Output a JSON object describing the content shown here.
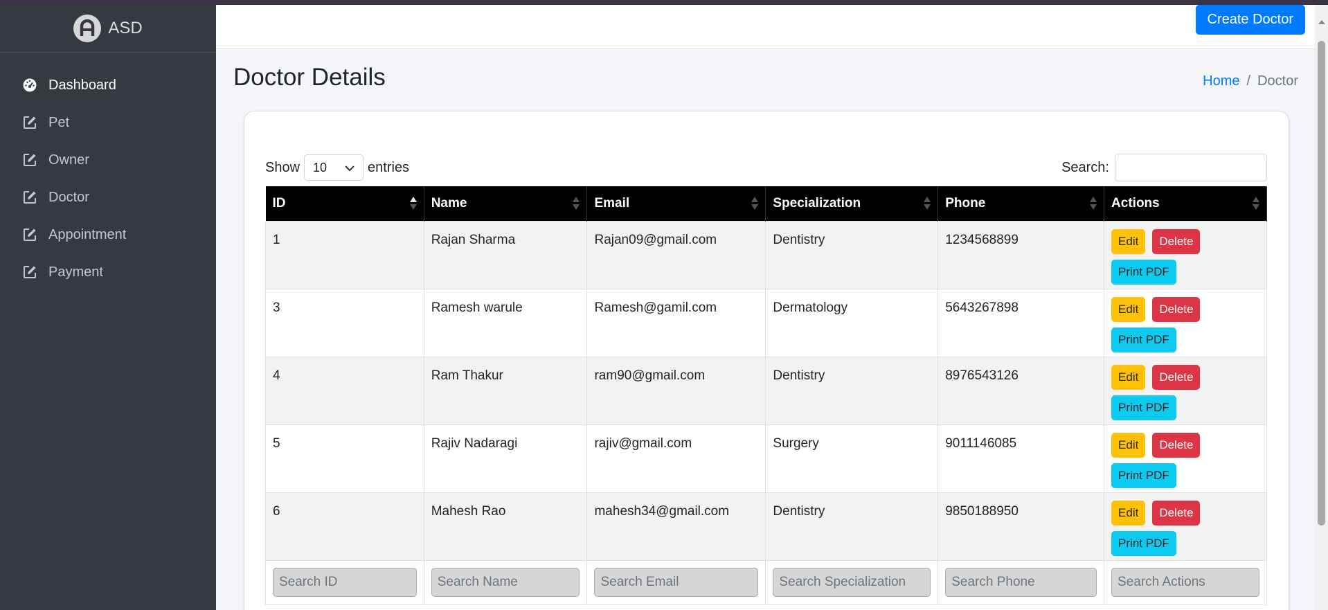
{
  "brand": {
    "name": "ASD"
  },
  "sidebar": {
    "items": [
      {
        "label": "Dashboard",
        "icon": "gauge-icon"
      },
      {
        "label": "Pet",
        "icon": "edit-icon"
      },
      {
        "label": "Owner",
        "icon": "edit-icon"
      },
      {
        "label": "Doctor",
        "icon": "edit-icon"
      },
      {
        "label": "Appointment",
        "icon": "edit-icon"
      },
      {
        "label": "Payment",
        "icon": "edit-icon"
      }
    ]
  },
  "header": {
    "create_label": "Create Doctor"
  },
  "page": {
    "title": "Doctor Details"
  },
  "breadcrumb": {
    "home": "Home",
    "separator": "/",
    "current": "Doctor"
  },
  "table_controls": {
    "show_label": "Show",
    "length_value": "10",
    "entries_label": "entries",
    "search_label": "Search:"
  },
  "table": {
    "columns": [
      "ID",
      "Name",
      "Email",
      "Specialization",
      "Phone",
      "Actions"
    ],
    "rows": [
      {
        "id": "1",
        "name": "Rajan Sharma",
        "email": "Rajan09@gmail.com",
        "specialization": "Dentistry",
        "phone": "1234568899"
      },
      {
        "id": "3",
        "name": "Ramesh warule",
        "email": "Ramesh@gamil.com",
        "specialization": "Dermatology",
        "phone": "5643267898"
      },
      {
        "id": "4",
        "name": "Ram Thakur",
        "email": "ram90@gmail.com",
        "specialization": "Dentistry",
        "phone": "8976543126"
      },
      {
        "id": "5",
        "name": "Rajiv Nadaragi",
        "email": "rajiv@gmail.com",
        "specialization": "Surgery",
        "phone": "9011146085"
      },
      {
        "id": "6",
        "name": "Mahesh Rao",
        "email": "mahesh34@gmail.com",
        "specialization": "Dentistry",
        "phone": "9850188950"
      }
    ],
    "actions": {
      "edit": "Edit",
      "delete": "Delete",
      "pdf": "Print PDF"
    },
    "filters": [
      "Search ID",
      "Search Name",
      "Search Email",
      "Search Specialization",
      "Search Phone",
      "Search Actions"
    ]
  },
  "colors": {
    "sidebar": "#343a40",
    "primary": "#007bff",
    "edit": "#ffc107",
    "delete": "#dc3545",
    "pdf": "#0dcaf0"
  }
}
